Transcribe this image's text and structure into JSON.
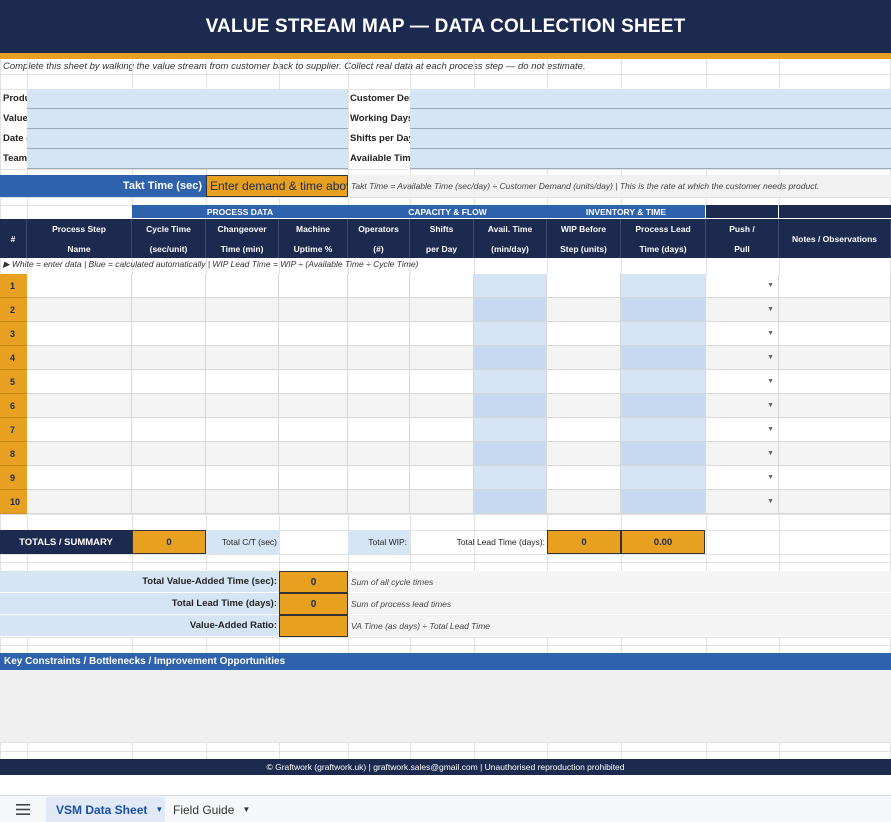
{
  "title": "VALUE STREAM MAP — DATA COLLECTION SHEET",
  "instructions": "Complete this sheet by walking the value stream from customer back to supplier. Collect real data at each process step — do not estimate.",
  "info_left": [
    {
      "label": "Produ"
    },
    {
      "label": "Value"
    },
    {
      "label": "Date c"
    },
    {
      "label": "Team"
    }
  ],
  "info_right": [
    {
      "label": "Customer Den"
    },
    {
      "label": "Working Days"
    },
    {
      "label": "Shifts per Day"
    },
    {
      "label": "Available Time"
    }
  ],
  "takt": {
    "label": "Takt Time (sec)",
    "value": "Enter demand & time above",
    "note": "Takt Time = Available Time (sec/day) ÷ Customer Demand (units/day)   |  This is the rate at which the customer needs product."
  },
  "groups": [
    "PROCESS DATA",
    "CAPACITY & FLOW",
    "INVENTORY & TIME"
  ],
  "headers": [
    {
      "l1": "#",
      "l2": ""
    },
    {
      "l1": "Process Step",
      "l2": "Name"
    },
    {
      "l1": "Cycle Time",
      "l2": "(sec/unit)"
    },
    {
      "l1": "Changeover",
      "l2": "Time (min)"
    },
    {
      "l1": "Machine",
      "l2": "Uptime %"
    },
    {
      "l1": "Operators",
      "l2": "(#)"
    },
    {
      "l1": "Shifts",
      "l2": "per Day"
    },
    {
      "l1": "Avail. Time",
      "l2": "(min/day)"
    },
    {
      "l1": "WIP Before",
      "l2": "Step (units)"
    },
    {
      "l1": "Process Lead",
      "l2": "Time (days)"
    },
    {
      "l1": "Push /",
      "l2": "Pull"
    },
    {
      "l1": "Notes / Observations",
      "l2": ""
    }
  ],
  "legend": "▶ White = enter data   |  Blue = calculated automatically   |  WIP Lead Time = WIP ÷ (Available Time ÷ Cycle Time)",
  "rows": [
    "1",
    "2",
    "3",
    "4",
    "5",
    "6",
    "7",
    "8",
    "9",
    "10"
  ],
  "dropdown_icon": "chevron-down-icon",
  "totals": {
    "label": "TOTALS / SUMMARY",
    "cycle_total": "0",
    "cycle_label": "Total C/T (sec)",
    "wip_label": "Total WIP:",
    "lead_label": "Total Lead Time (days):",
    "wip_value": "0",
    "lead_value": "0.00"
  },
  "summary": [
    {
      "label": "Total Value-Added Time (sec):",
      "value": "0",
      "note": "Sum of all cycle times"
    },
    {
      "label": "Total Lead Time (days):",
      "value": "0",
      "note": "Sum of process lead times"
    },
    {
      "label": "Value-Added Ratio:",
      "value": "",
      "note": "VA Time (as days) ÷ Total Lead Time"
    }
  ],
  "constraints_title": "Key Constraints / Bottlenecks / Improvement Opportunities",
  "footer": "© Graftwork (graftwork.uk)  |  graftwork.sales@gmail.com  |  Unauthorised reproduction prohibited",
  "sheet_tabs": [
    {
      "label": "VSM Data Sheet",
      "active": true
    },
    {
      "label": "Field Guide",
      "active": false
    }
  ],
  "colors": {
    "navy": "#1b2a4e",
    "blue": "#2f62ad",
    "gold": "#e8a020",
    "light_blue": "#d6e5f5"
  }
}
